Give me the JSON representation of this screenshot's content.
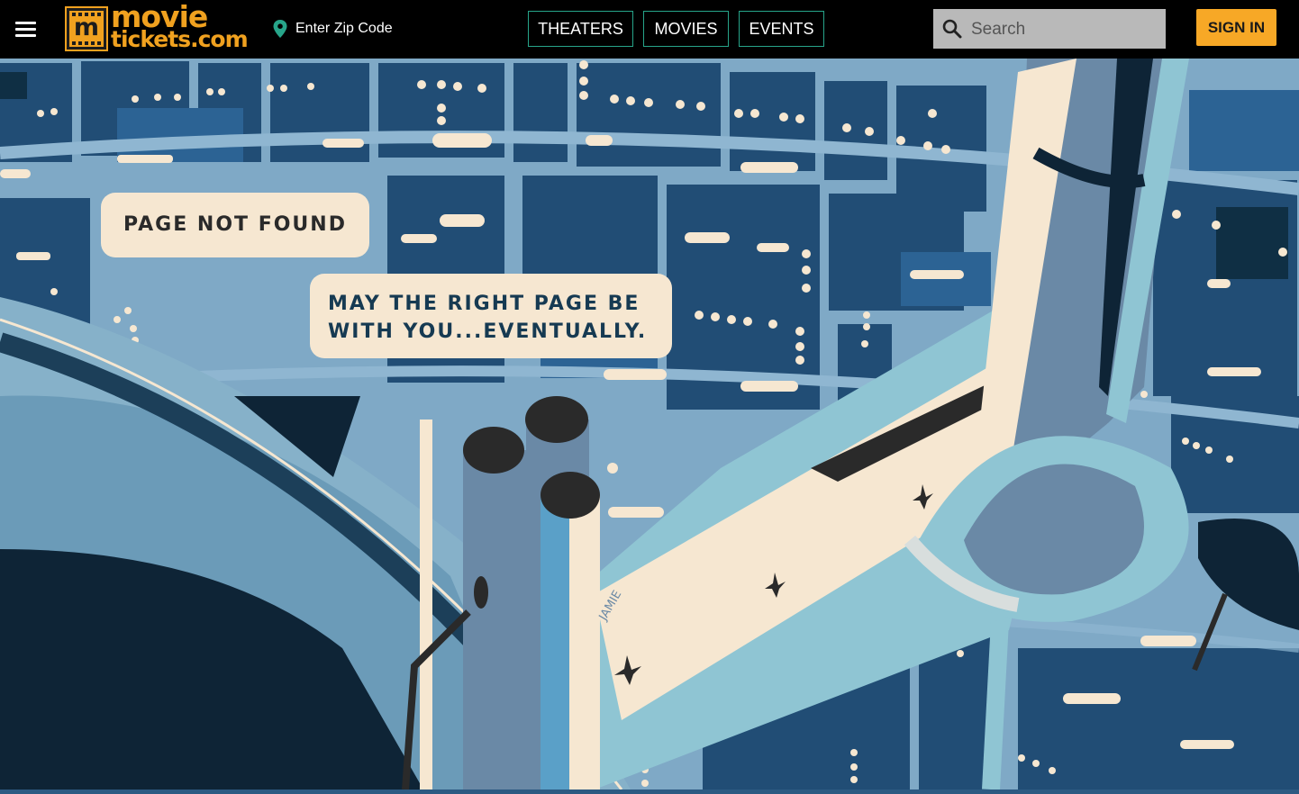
{
  "header": {
    "menu_icon": "hamburger-menu-icon",
    "logo": {
      "line1": "movie",
      "line2": "tickets.com",
      "mark": "m"
    },
    "zip": {
      "icon": "location-pin-icon",
      "label": "Enter Zip Code"
    },
    "nav": [
      {
        "id": "theaters",
        "label": "THEATERS"
      },
      {
        "id": "movies",
        "label": "MOVIES"
      },
      {
        "id": "events",
        "label": "EVENTS"
      }
    ],
    "search": {
      "icon": "search-icon",
      "placeholder": "Search",
      "value": ""
    },
    "sign_in_label": "SIGN IN"
  },
  "error": {
    "title": "Page Not Found",
    "message_line1": "May the right page be",
    "message_line2": "with you...eventually."
  },
  "illustration": {
    "signature": "JAMIE"
  },
  "colors": {
    "header_bg": "#000000",
    "brand_orange": "#f0a11f",
    "sign_in_bg": "#f7a826",
    "nav_border": "#27a58a",
    "bubble_bg": "#f6e7d1",
    "bubble_text": "#163a52"
  }
}
